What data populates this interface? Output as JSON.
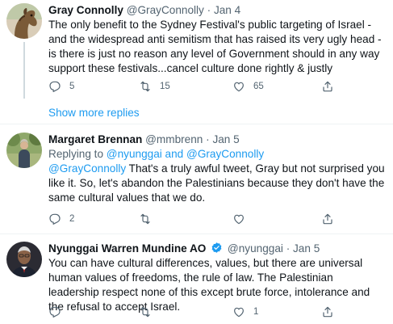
{
  "tweets": [
    {
      "name": "Gray Connolly",
      "handle": "@GrayConnolly",
      "separator": "·",
      "date": "Jan 4",
      "text": "The only benefit to the Sydney Festival's public targeting of Israel - and the widespread anti semitism that has raised its very ugly head - is there is just no reason any level of Government should in any way support these festivals...cancel culture done rightly & justly",
      "replies": "5",
      "retweets": "15",
      "likes": "65"
    },
    {
      "name": "Margaret Brennan",
      "handle": "@mmbrenn",
      "separator": "·",
      "date": "Jan 5",
      "reply_prefix": "Replying to ",
      "reply_user1": "@nyunggai",
      "reply_and": " and ",
      "reply_user2": "@GrayConnolly",
      "mention": "@GrayConnolly",
      "text": " That's a truly awful tweet, Gray but not surprised you like it. So, let's abandon the Palestinians because they don't have the same cultural values that we do.",
      "replies": "2",
      "retweets": "",
      "likes": ""
    },
    {
      "name": "Nyunggai Warren Mundine AO",
      "handle": "@nyunggai",
      "separator": "·",
      "date": "Jan 5",
      "text": "You can have cultural differences, values, but there are universal human values of freedoms, the rule of law. The Palestinian leadership respect none of this except brute force, intolerance and the refusal to accept Israel.",
      "replies": "",
      "retweets": "",
      "likes": "1"
    }
  ],
  "show_more_replies": "Show more replies",
  "icons": {
    "reply": "reply-icon",
    "retweet": "retweet-icon",
    "like": "like-icon",
    "share": "share-icon",
    "verified": "verified-badge-icon"
  },
  "colors": {
    "link": "#1d9bf0",
    "secondary_text": "#536471",
    "divider": "#eff3f4",
    "thread_line": "#cfd9de"
  }
}
